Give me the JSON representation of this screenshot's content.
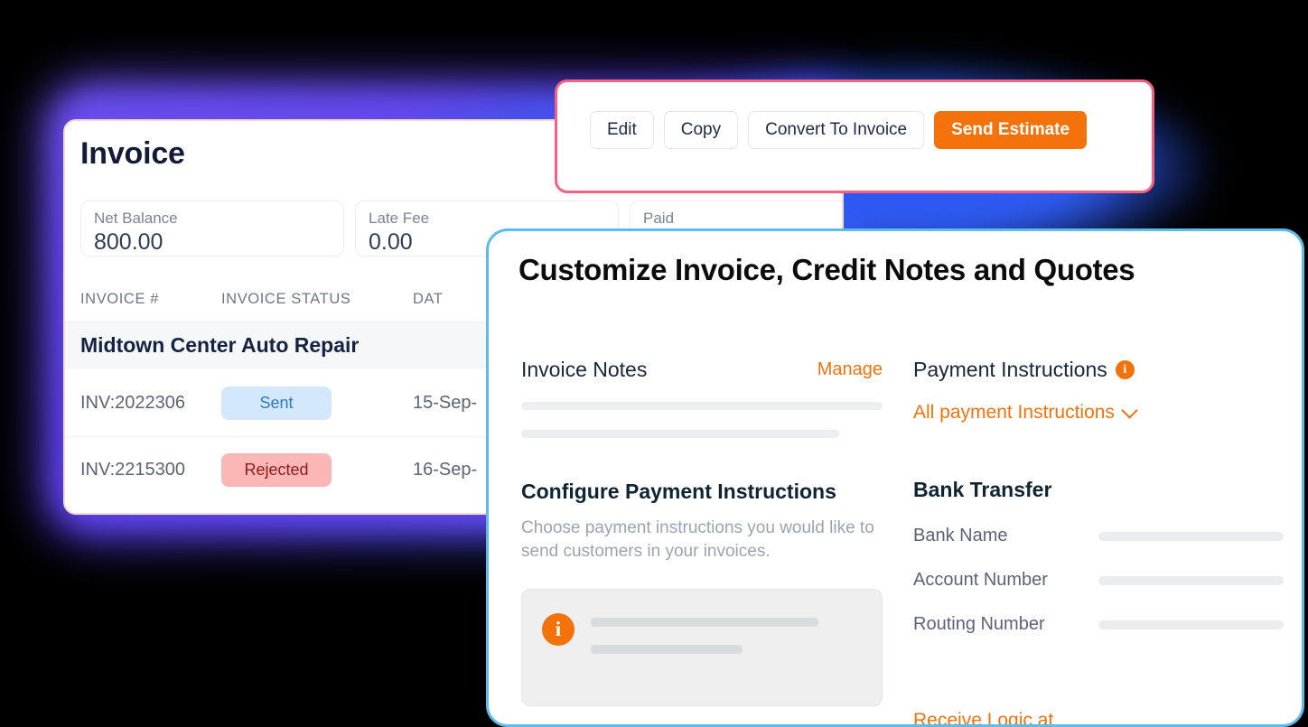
{
  "colors": {
    "accent_orange": "#f4720b",
    "panel_border_blue": "#5cbcea",
    "action_border_pink": "#f9607f",
    "glow_purple": "#6b4ff0",
    "glow_blue": "#2f5bf0",
    "badge_sent_bg": "#d4e8fb",
    "badge_sent_text": "#2a7ac9",
    "badge_rejected_bg": "#fbb6b6",
    "badge_rejected_text": "#8e1b1b"
  },
  "invoice_card": {
    "title": "Invoice",
    "stats": [
      {
        "label": "Net Balance",
        "value": "800.00"
      },
      {
        "label": "Late Fee",
        "value": "0.00"
      },
      {
        "label": "Paid",
        "value": ""
      }
    ],
    "columns": [
      "INVOICE #",
      "INVOICE STATUS",
      "DAT"
    ],
    "group_label": "Midtown Center Auto Repair",
    "rows": [
      {
        "invoice": "INV:2022306",
        "status": "Sent",
        "status_kind": "sent",
        "date": "15-Sep-"
      },
      {
        "invoice": "INV:2215300",
        "status": "Rejected",
        "status_kind": "rejected",
        "date": "16-Sep-"
      }
    ]
  },
  "action_bar": {
    "buttons": [
      {
        "label": "Edit",
        "style": "ghost"
      },
      {
        "label": "Copy",
        "style": "ghost"
      },
      {
        "label": "Convert To Invoice",
        "style": "ghost"
      },
      {
        "label": "Send Estimate",
        "style": "primary"
      }
    ]
  },
  "panel": {
    "title": "Customize Invoice, Credit Notes and Quotes",
    "invoice_notes": {
      "title": "Invoice Notes",
      "manage_label": "Manage"
    },
    "configure": {
      "title": "Configure Payment Instructions",
      "description": "Choose payment instructions you would like to send customers in your invoices.",
      "info_icon": "info-icon"
    },
    "payment_instructions": {
      "title": "Payment Instructions",
      "info_icon": "info-icon",
      "selected_option": "All payment Instructions",
      "chevron": "chevron-down-icon"
    },
    "bank_transfer": {
      "title": "Bank Transfer",
      "fields": [
        {
          "label": "Bank Name",
          "value": ""
        },
        {
          "label": "Account Number",
          "value": ""
        },
        {
          "label": "Routing Number",
          "value": ""
        }
      ]
    },
    "bottom_link": "Receive Logic at"
  }
}
